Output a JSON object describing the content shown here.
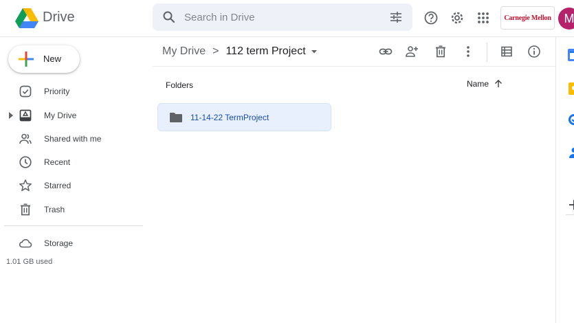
{
  "app": {
    "brand": "Drive",
    "search_placeholder": "Search in Drive",
    "org_name": "Carnegie Mellon",
    "avatar_initial": "M"
  },
  "sidebar": {
    "new_label": "New",
    "items": [
      {
        "label": "Priority",
        "icon": "priority-check-icon"
      },
      {
        "label": "My Drive",
        "icon": "my-drive-icon"
      },
      {
        "label": "Shared with me",
        "icon": "shared-people-icon"
      },
      {
        "label": "Recent",
        "icon": "clock-icon"
      },
      {
        "label": "Starred",
        "icon": "star-icon"
      },
      {
        "label": "Trash",
        "icon": "trash-icon"
      }
    ],
    "storage_label": "Storage",
    "storage_used": "1.01 GB used"
  },
  "main": {
    "breadcrumb_root": "My Drive",
    "breadcrumb_separator": ">",
    "breadcrumb_current": "112 term Project",
    "folders_title": "Folders",
    "sort_label": "Name",
    "folders": [
      {
        "name": "11-14-22 TermProject"
      }
    ]
  },
  "colors": {
    "accent_blue": "#1a73e8",
    "selected_folder_bg": "#e8f0fe",
    "avatar_bg": "#b5216b",
    "org_red": "#c41230"
  }
}
